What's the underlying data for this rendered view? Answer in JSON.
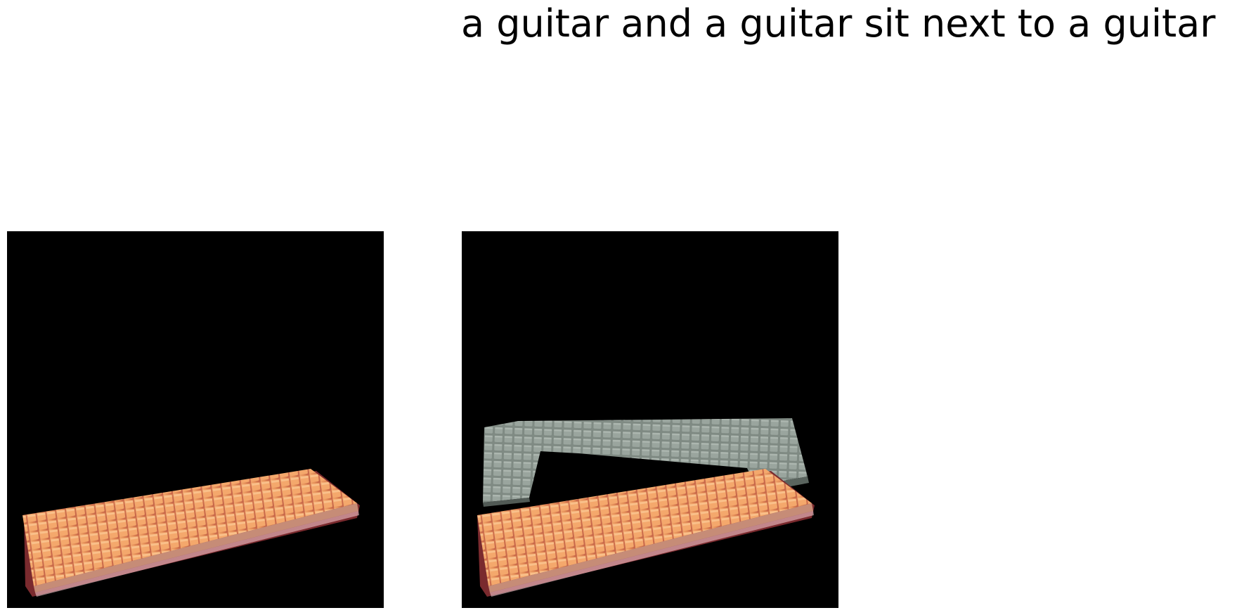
{
  "caption": "a guitar and a guitar sit next to a guitar",
  "panels": [
    {
      "name": "input-render",
      "objects": [
        "orange-keyboard"
      ]
    },
    {
      "name": "output-render",
      "objects": [
        "gray-keyboard",
        "orange-keyboard"
      ]
    }
  ],
  "colors": {
    "background": "#000000",
    "orange_keyboard": "#e89a5e",
    "orange_keyboard_shadow": "#7a2a2e",
    "gray_keyboard": "#8e9a92",
    "gray_keyboard_shadow": "#5a645e"
  }
}
